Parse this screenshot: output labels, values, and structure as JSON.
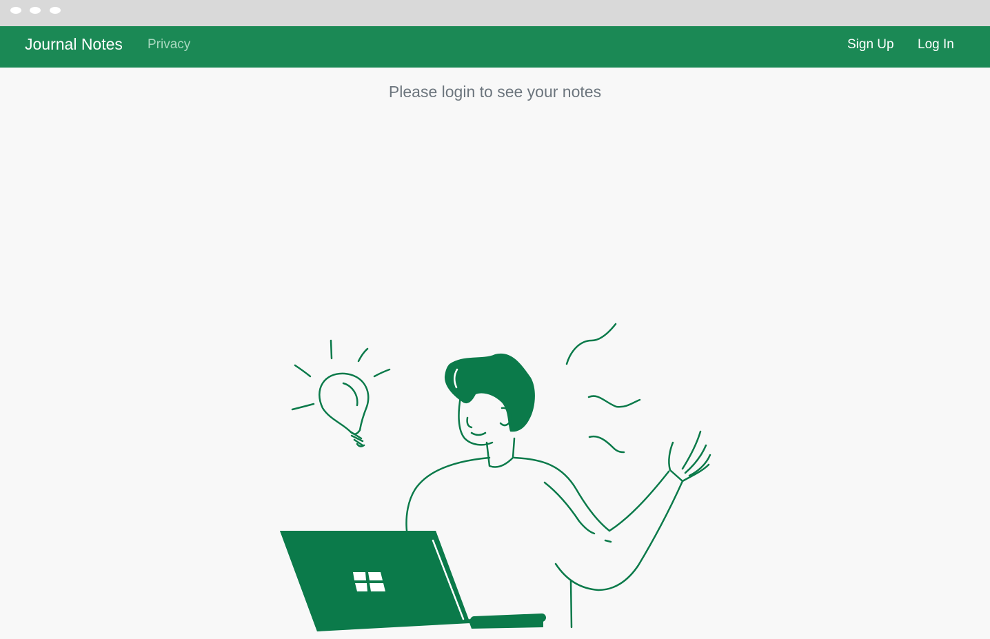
{
  "navbar": {
    "brand": "Journal Notes",
    "links": {
      "privacy": "Privacy",
      "sign_up": "Sign Up",
      "log_in": "Log In"
    },
    "background_color": "#1b8955"
  },
  "main": {
    "message": "Please login to see your notes"
  },
  "illustration": {
    "icon": "person-with-laptop-and-lightbulb",
    "accent_color": "#0b7a4a"
  }
}
